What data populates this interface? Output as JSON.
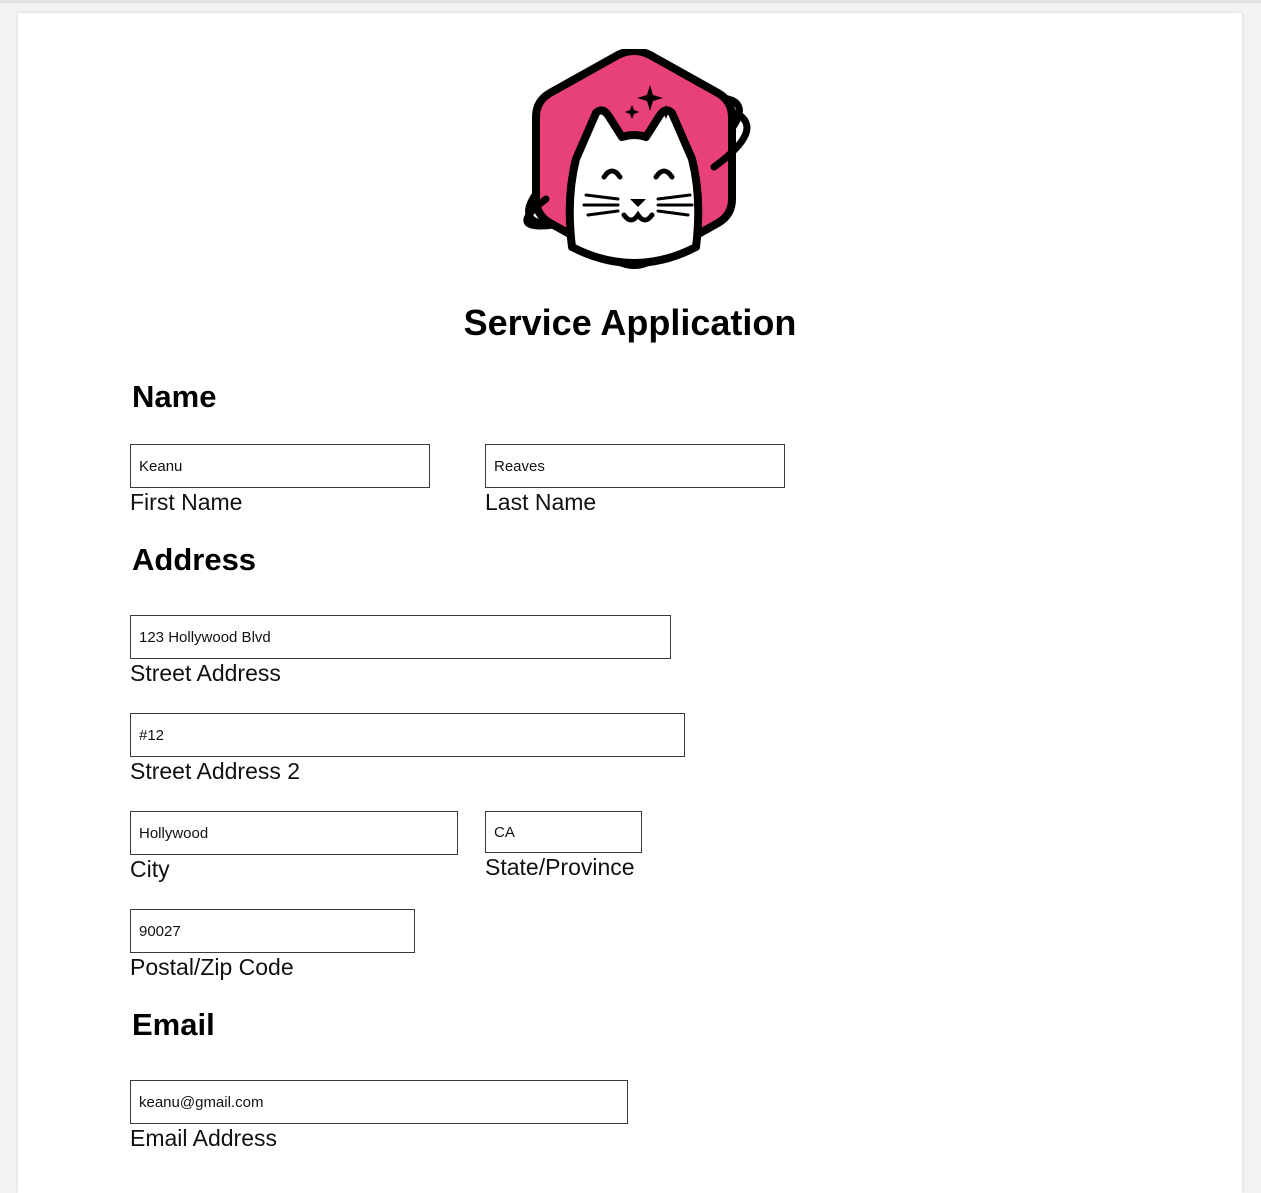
{
  "form": {
    "title": "Service Application"
  },
  "sections": {
    "name": {
      "heading": "Name",
      "first_name": {
        "value": "Keanu",
        "label": "First Name"
      },
      "last_name": {
        "value": "Reaves",
        "label": "Last Name"
      }
    },
    "address": {
      "heading": "Address",
      "street": {
        "value": "123 Hollywood Blvd",
        "label": "Street Address"
      },
      "street2": {
        "value": "#12",
        "label": "Street Address 2"
      },
      "city": {
        "value": "Hollywood",
        "label": "City"
      },
      "state": {
        "value": "CA",
        "label": "State/Province"
      },
      "zip": {
        "value": "90027",
        "label": "Postal/Zip Code"
      }
    },
    "email": {
      "heading": "Email",
      "address": {
        "value": "keanu@gmail.com",
        "label": "Email Address"
      }
    }
  },
  "colors": {
    "logo_pink": "#e8407a",
    "logo_outline": "#000000",
    "field_border": "#3a3a3a",
    "page_background": "#f3f2f0"
  },
  "icons": {
    "logo": "cat-astronaut-logo-icon"
  }
}
